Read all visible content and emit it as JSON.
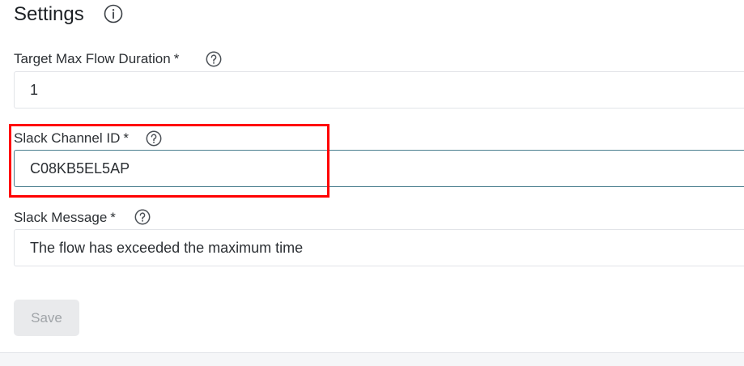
{
  "page": {
    "title": "Settings"
  },
  "fields": {
    "max_duration": {
      "label": "Target Max Flow Duration",
      "required_mark": "*",
      "value": "1"
    },
    "channel_id": {
      "label": "Slack Channel ID",
      "required_mark": "*",
      "value": "C08KB5EL5AP"
    },
    "message": {
      "label": "Slack Message",
      "required_mark": "*",
      "value": "The flow has exceeded the maximum time"
    }
  },
  "actions": {
    "save_label": "Save"
  },
  "icons": {
    "title_icon": "info-circle-icon",
    "field_help_icon": "question-circle-icon"
  },
  "colors": {
    "highlight": "#ff0000",
    "focused_border": "#4b7f8f",
    "disabled_button_bg": "#e9eaec",
    "disabled_button_text": "#a0a4a8"
  }
}
